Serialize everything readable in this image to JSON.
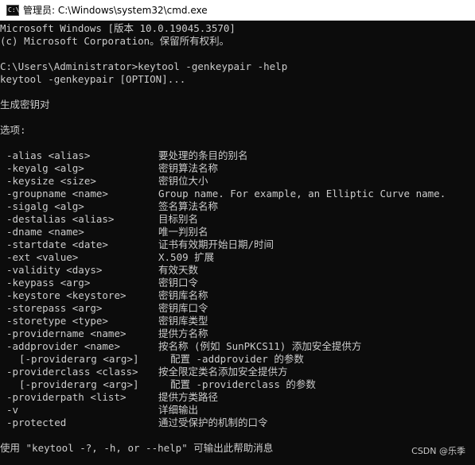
{
  "window": {
    "title": "管理员: C:\\Windows\\system32\\cmd.exe",
    "icon_text": "C:\\"
  },
  "console": {
    "header": [
      "Microsoft Windows [版本 10.0.19045.3570]",
      "(c) Microsoft Corporation。保留所有权利。",
      "",
      "C:\\Users\\Administrator>keytool -genkeypair -help",
      "keytool -genkeypair [OPTION]...",
      "",
      "生成密钥对",
      "",
      "选项:",
      ""
    ],
    "options": [
      {
        "opt": "-alias <alias>",
        "desc": "要处理的条目的别名"
      },
      {
        "opt": "-keyalg <alg>",
        "desc": "密钥算法名称"
      },
      {
        "opt": "-keysize <size>",
        "desc": "密钥位大小"
      },
      {
        "opt": "-groupname <name>",
        "desc": "Group name. For example, an Elliptic Curve name."
      },
      {
        "opt": "-sigalg <alg>",
        "desc": "签名算法名称"
      },
      {
        "opt": "-destalias <alias>",
        "desc": "目标别名"
      },
      {
        "opt": "-dname <name>",
        "desc": "唯一判别名"
      },
      {
        "opt": "-startdate <date>",
        "desc": "证书有效期开始日期/时间"
      },
      {
        "opt": "-ext <value>",
        "desc": "X.509 扩展"
      },
      {
        "opt": "-validity <days>",
        "desc": "有效天数"
      },
      {
        "opt": "-keypass <arg>",
        "desc": "密钥口令"
      },
      {
        "opt": "-keystore <keystore>",
        "desc": "密钥库名称"
      },
      {
        "opt": "-storepass <arg>",
        "desc": "密钥库口令"
      },
      {
        "opt": "-storetype <type>",
        "desc": "密钥库类型"
      },
      {
        "opt": "-providername <name>",
        "desc": "提供方名称"
      },
      {
        "opt": "-addprovider <name>",
        "desc": "按名称 (例如 SunPKCS11) 添加安全提供方"
      },
      {
        "sub": "[-providerarg <arg>]",
        "desc": "配置 -addprovider 的参数"
      },
      {
        "opt": "-providerclass <class>",
        "desc": "按全限定类名添加安全提供方"
      },
      {
        "sub": "[-providerarg <arg>]",
        "desc": "配置 -providerclass 的参数"
      },
      {
        "opt": "-providerpath <list>",
        "desc": "提供方类路径"
      },
      {
        "opt": "-v",
        "desc": "详细输出"
      },
      {
        "opt": "-protected",
        "desc": "通过受保护的机制的口令"
      }
    ],
    "footer": [
      "",
      "使用 \"keytool -?, -h, or --help\" 可输出此帮助消息"
    ]
  },
  "watermark": "CSDN @乐季",
  "colors": {
    "background": "#0c0c0c",
    "foreground": "#cccccc",
    "titlebar": "#ffffff"
  }
}
